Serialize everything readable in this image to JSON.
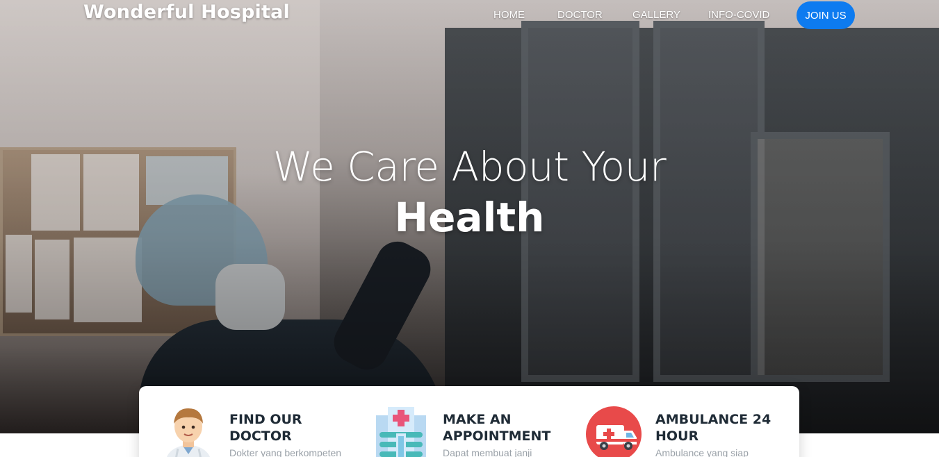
{
  "brand": {
    "name": "Wonderful Hospital"
  },
  "nav": {
    "items": [
      {
        "label": "HOME"
      },
      {
        "label": "DOCTOR"
      },
      {
        "label": "GALLERY"
      },
      {
        "label": "INFO-COVID"
      }
    ],
    "cta_label": "JOIN US",
    "cta_color": "#0d7bf0"
  },
  "hero": {
    "line1": "We Care About Your",
    "line2": "Health"
  },
  "features": [
    {
      "title": "FIND OUR DOCTOR",
      "description": "Dokter yang berkompeten",
      "icon": "doctor-icon"
    },
    {
      "title": "MAKE AN APPOINTMENT",
      "description": "Dapat membuat janji",
      "icon": "hospital-building-icon"
    },
    {
      "title": "AMBULANCE 24 HOUR",
      "description": "Ambulance yang siap",
      "icon": "ambulance-icon"
    }
  ]
}
